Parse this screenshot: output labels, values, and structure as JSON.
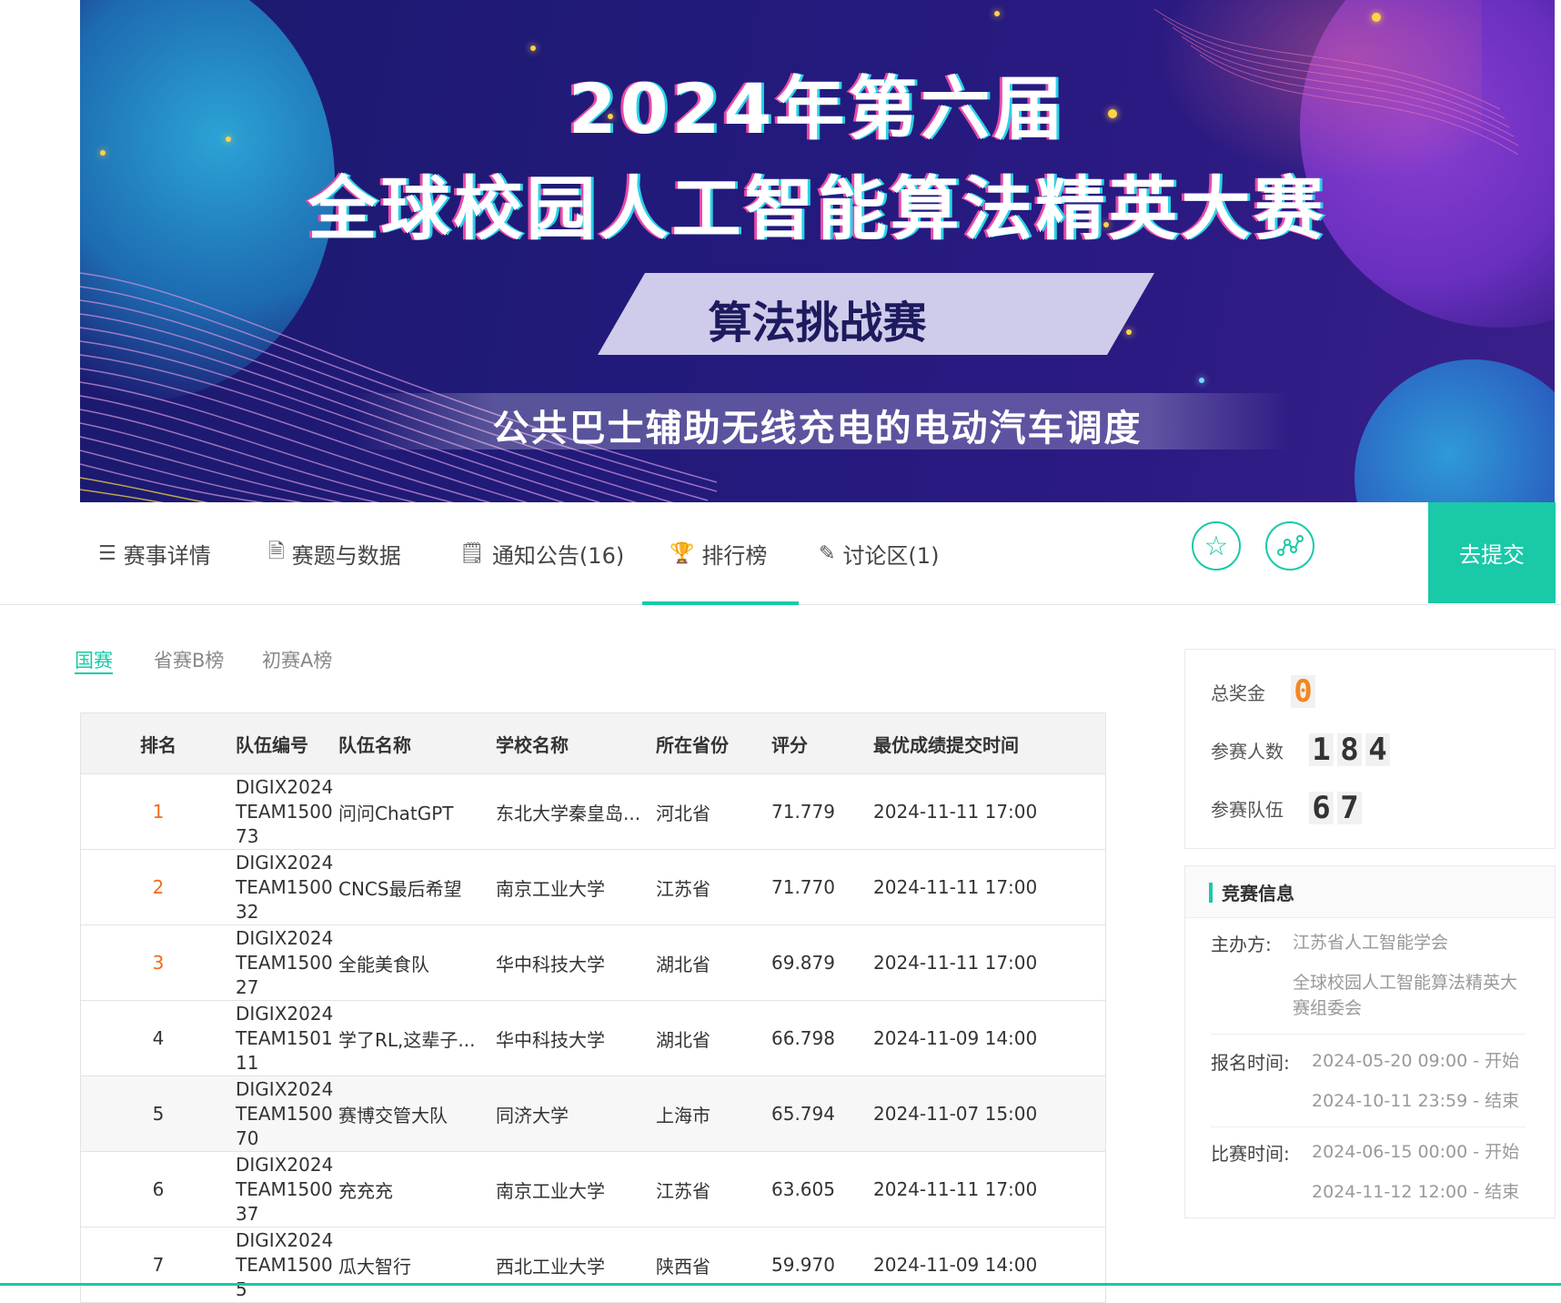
{
  "banner": {
    "title_line1": "2024年第六届",
    "title_line2": "全球校园人工智能算法精英大赛",
    "subtitle": "算法挑战赛",
    "topic": "公共巴士辅助无线充电的电动汽车调度"
  },
  "tabs": [
    {
      "label": "赛事详情",
      "icon": "list-icon"
    },
    {
      "label": "赛题与数据",
      "icon": "document-icon"
    },
    {
      "label": "通知公告(16)",
      "icon": "notice-icon"
    },
    {
      "label": "排行榜",
      "icon": "trophy-icon"
    },
    {
      "label": "讨论区(1)",
      "icon": "edit-icon"
    }
  ],
  "actions": {
    "favorite_icon": "star-icon",
    "share_icon": "share-icon",
    "submit_label": "去提交"
  },
  "subtabs": [
    "国赛",
    "省赛B榜",
    "初赛A榜"
  ],
  "table": {
    "headers": [
      "排名",
      "队伍编号",
      "队伍名称",
      "学校名称",
      "所在省份",
      "评分",
      "最优成绩提交时间"
    ],
    "rows": [
      {
        "rank": "1",
        "id": "DIGIX2024TEAM150073",
        "name": "问问ChatGPT",
        "school": "东北大学秦皇岛...",
        "province": "河北省",
        "score": "71.779",
        "time": "2024-11-11 17:00"
      },
      {
        "rank": "2",
        "id": "DIGIX2024TEAM150032",
        "name": "CNCS最后希望",
        "school": "南京工业大学",
        "province": "江苏省",
        "score": "71.770",
        "time": "2024-11-11 17:00"
      },
      {
        "rank": "3",
        "id": "DIGIX2024TEAM150027",
        "name": "全能美食队",
        "school": "华中科技大学",
        "province": "湖北省",
        "score": "69.879",
        "time": "2024-11-11 17:00"
      },
      {
        "rank": "4",
        "id": "DIGIX2024TEAM150111",
        "name": "学了RL,这辈子...",
        "school": "华中科技大学",
        "province": "湖北省",
        "score": "66.798",
        "time": "2024-11-09 14:00"
      },
      {
        "rank": "5",
        "id": "DIGIX2024TEAM150070",
        "name": "赛博交管大队",
        "school": "同济大学",
        "province": "上海市",
        "score": "65.794",
        "time": "2024-11-07 15:00"
      },
      {
        "rank": "6",
        "id": "DIGIX2024TEAM150037",
        "name": "充充充",
        "school": "南京工业大学",
        "province": "江苏省",
        "score": "63.605",
        "time": "2024-11-11 17:00"
      },
      {
        "rank": "7",
        "id": "DIGIX2024TEAM15005",
        "name": "瓜大智行",
        "school": "西北工业大学",
        "province": "陕西省",
        "score": "59.970",
        "time": "2024-11-09 14:00"
      }
    ]
  },
  "stats": {
    "prize_label": "总奖金",
    "prize_value": "0",
    "participants_label": "参赛人数",
    "participants_value": "184",
    "teams_label": "参赛队伍",
    "teams_value": "67"
  },
  "info": {
    "title": "竞赛信息",
    "organizer_label": "主办方:",
    "organizer_1": "江苏省人工智能学会",
    "organizer_2": "全球校园人工智能算法精英大赛组委会",
    "signup_label": "报名时间:",
    "signup_start": "2024-05-20 09:00 - 开始",
    "signup_end": "2024-10-11 23:59 - 结束",
    "contest_label": "比赛时间:",
    "contest_start": "2024-06-15 00:00 - 开始",
    "contest_end": "2024-11-12 12:00 - 结束"
  },
  "colors": {
    "accent": "#19c9a8",
    "rank_top": "#f26a1b",
    "banner_bg": "#231a7c"
  }
}
